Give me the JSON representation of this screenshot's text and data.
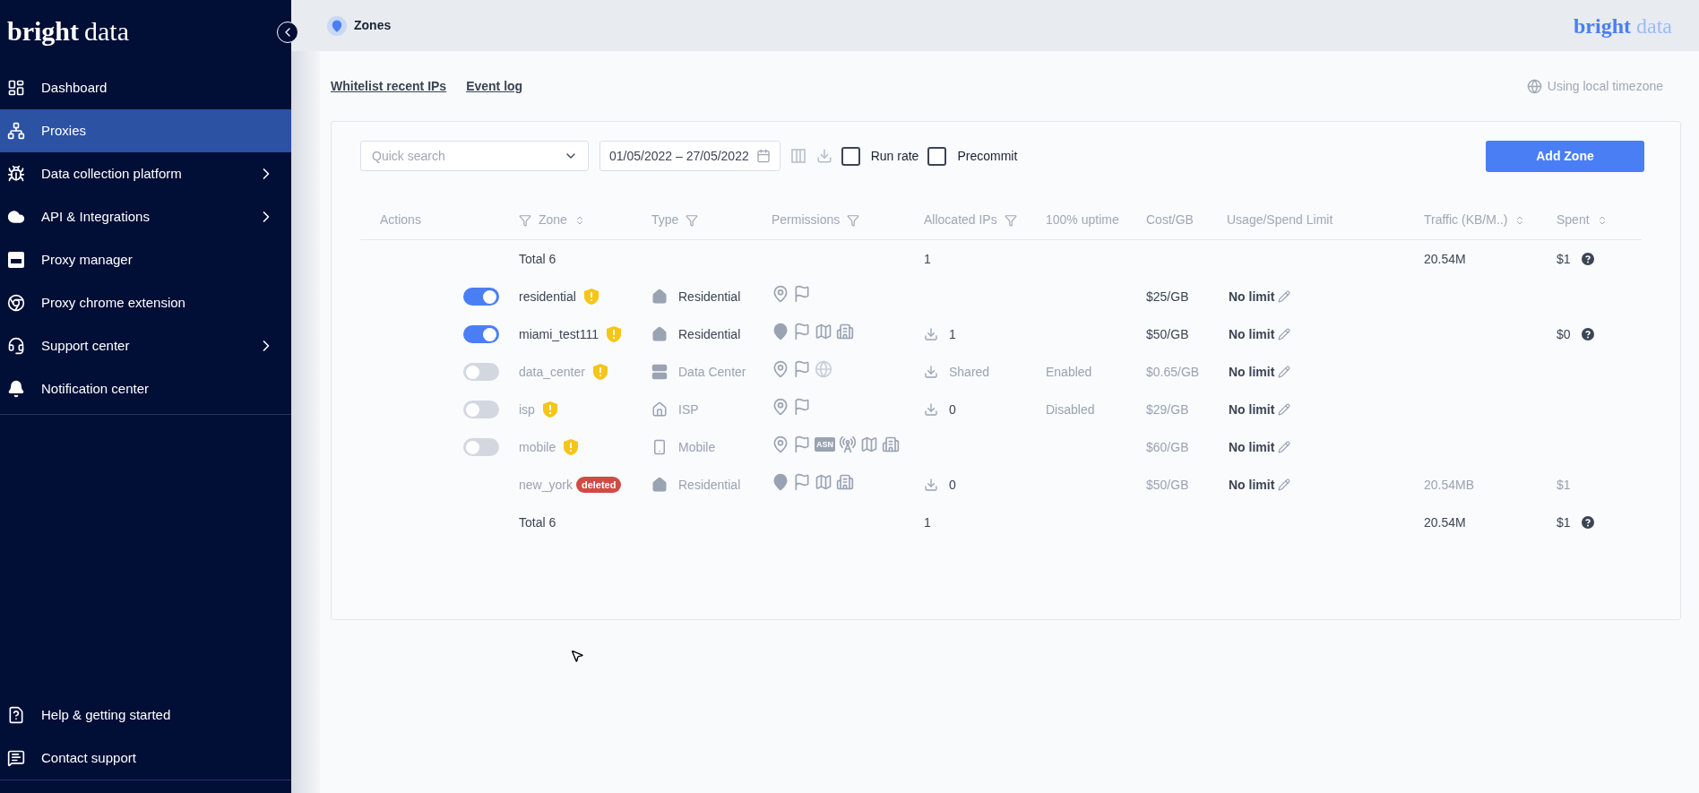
{
  "sidebar": {
    "logo": [
      "bright",
      "data"
    ],
    "items": [
      {
        "label": "Dashboard",
        "selected": false,
        "submenu": false
      },
      {
        "label": "Proxies",
        "selected": true,
        "submenu": false
      },
      {
        "label": "Data collection platform",
        "selected": false,
        "submenu": true
      },
      {
        "label": "API & Integrations",
        "selected": false,
        "submenu": true
      },
      {
        "label": "Proxy manager",
        "selected": false,
        "submenu": false
      },
      {
        "label": "Proxy chrome extension",
        "selected": false,
        "submenu": false
      },
      {
        "label": "Support center",
        "selected": false,
        "submenu": true
      },
      {
        "label": "Notification center",
        "selected": false,
        "submenu": false
      }
    ],
    "bottom_items": [
      {
        "label": "Help & getting started"
      },
      {
        "label": "Contact support"
      }
    ]
  },
  "header": {
    "title": "Zones",
    "logo": [
      "bright",
      "data"
    ]
  },
  "links": [
    "Whitelist recent IPs",
    "Event log"
  ],
  "timezone": "Using local timezone",
  "toolbar": {
    "search_placeholder": "Quick search",
    "date_range": "01/05/2022 – 27/05/2022",
    "checkboxes": [
      {
        "label": "Run rate",
        "checked": false
      },
      {
        "label": "Precommit",
        "checked": false
      }
    ],
    "add_button": "Add Zone"
  },
  "table": {
    "columns": [
      {
        "label": "Actions",
        "filter": false,
        "sort": false
      },
      {
        "label": "Zone",
        "filter": true,
        "sort": true
      },
      {
        "label": "Type",
        "filter": true,
        "sort": false
      },
      {
        "label": "Permissions",
        "filter": true,
        "sort": false
      },
      {
        "label": "Allocated IPs",
        "filter": true,
        "sort": false
      },
      {
        "label": "100% uptime",
        "filter": false,
        "sort": false
      },
      {
        "label": "Cost/GB",
        "filter": false,
        "sort": false
      },
      {
        "label": "Usage/Spend Limit",
        "filter": false,
        "sort": false
      },
      {
        "label": "Traffic (KB/M..)",
        "filter": false,
        "sort": true
      },
      {
        "label": "Spent",
        "filter": false,
        "sort": true
      }
    ],
    "rows": [
      {
        "kind": "total",
        "label": "Total 6",
        "allocated": "1",
        "traffic": "20.54M",
        "spent": "$1"
      },
      {
        "kind": "zone",
        "on": true,
        "active": true,
        "name": "residential",
        "warning": true,
        "type": "Residential",
        "permissions": [
          {
            "kind": "pin"
          },
          {
            "kind": "flag"
          }
        ],
        "cost": "$25/GB",
        "limit": "No limit"
      },
      {
        "kind": "zone",
        "on": true,
        "active": true,
        "name": "miami_test111",
        "warning": true,
        "type": "Residential",
        "permissions": [
          {
            "kind": "gpin"
          },
          {
            "kind": "flag"
          },
          {
            "kind": "map"
          },
          {
            "kind": "city"
          }
        ],
        "allocated": "1",
        "cost": "$50/GB",
        "limit": "No limit",
        "spent": "$0"
      },
      {
        "kind": "zone",
        "on": false,
        "active": false,
        "name": "data_center",
        "warning": true,
        "type": "Data Center",
        "permissions": [
          {
            "kind": "pin"
          },
          {
            "kind": "flag"
          },
          {
            "kind": "globe"
          }
        ],
        "allocated": "Shared",
        "uptime": "Enabled",
        "cost": "$0.65/GB",
        "limit": "No limit"
      },
      {
        "kind": "zone",
        "on": false,
        "active": false,
        "name": "isp",
        "warning": true,
        "type": "ISP",
        "permissions": [
          {
            "kind": "pin"
          },
          {
            "kind": "flag"
          }
        ],
        "allocated": "0",
        "uptime": "Disabled",
        "cost": "$29/GB",
        "limit": "No limit"
      },
      {
        "kind": "zone",
        "on": false,
        "active": false,
        "name": "mobile",
        "warning": true,
        "type": "Mobile",
        "permissions": [
          {
            "kind": "pin"
          },
          {
            "kind": "flag"
          },
          {
            "kind": "asn",
            "label": "ASN"
          },
          {
            "kind": "tower"
          },
          {
            "kind": "map"
          },
          {
            "kind": "city"
          }
        ],
        "cost": "$60/GB",
        "limit": "No limit"
      },
      {
        "kind": "zone",
        "active": false,
        "name": "new_york",
        "deleted_label": "deleted",
        "type": "Residential",
        "permissions": [
          {
            "kind": "gpin"
          },
          {
            "kind": "flag"
          },
          {
            "kind": "map"
          },
          {
            "kind": "city"
          }
        ],
        "allocated": "0",
        "cost": "$50/GB",
        "limit": "No limit",
        "traffic": "20.54MB",
        "spent": "$1"
      },
      {
        "kind": "total",
        "label": "Total 6",
        "allocated": "1",
        "traffic": "20.54M",
        "spent": "$1"
      }
    ]
  }
}
